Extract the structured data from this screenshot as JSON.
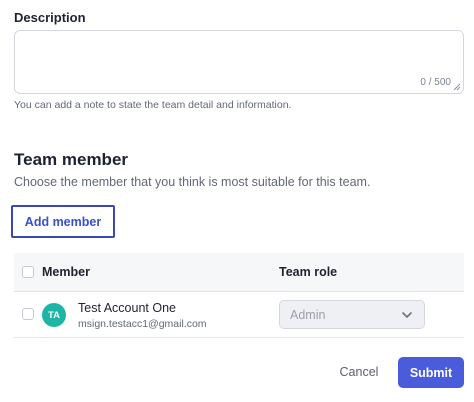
{
  "description": {
    "label": "Description",
    "value": "",
    "counter": "0 / 500",
    "help_text": "You can add a note to state the team detail and information."
  },
  "team_member": {
    "title": "Team member",
    "description": "Choose the member that you think is most suitable for this team.",
    "add_button_label": "Add member"
  },
  "table": {
    "columns": [
      "Member",
      "Team role"
    ],
    "rows": [
      {
        "checked": false,
        "initials": "TA",
        "avatar_color": "#1fb5a6",
        "name": "Test Account One",
        "email": "msign.testacc1@gmail.com",
        "role": "Admin",
        "role_disabled": true
      }
    ]
  },
  "footer": {
    "cancel_label": "Cancel",
    "submit_label": "Submit"
  },
  "colors": {
    "primary": "#4a5bdb",
    "focus_outline": "#3a48b8",
    "avatar": "#1fb5a6"
  },
  "icons": {
    "dropdown": "chevron-down-icon",
    "resize": "resize-handle-icon"
  }
}
